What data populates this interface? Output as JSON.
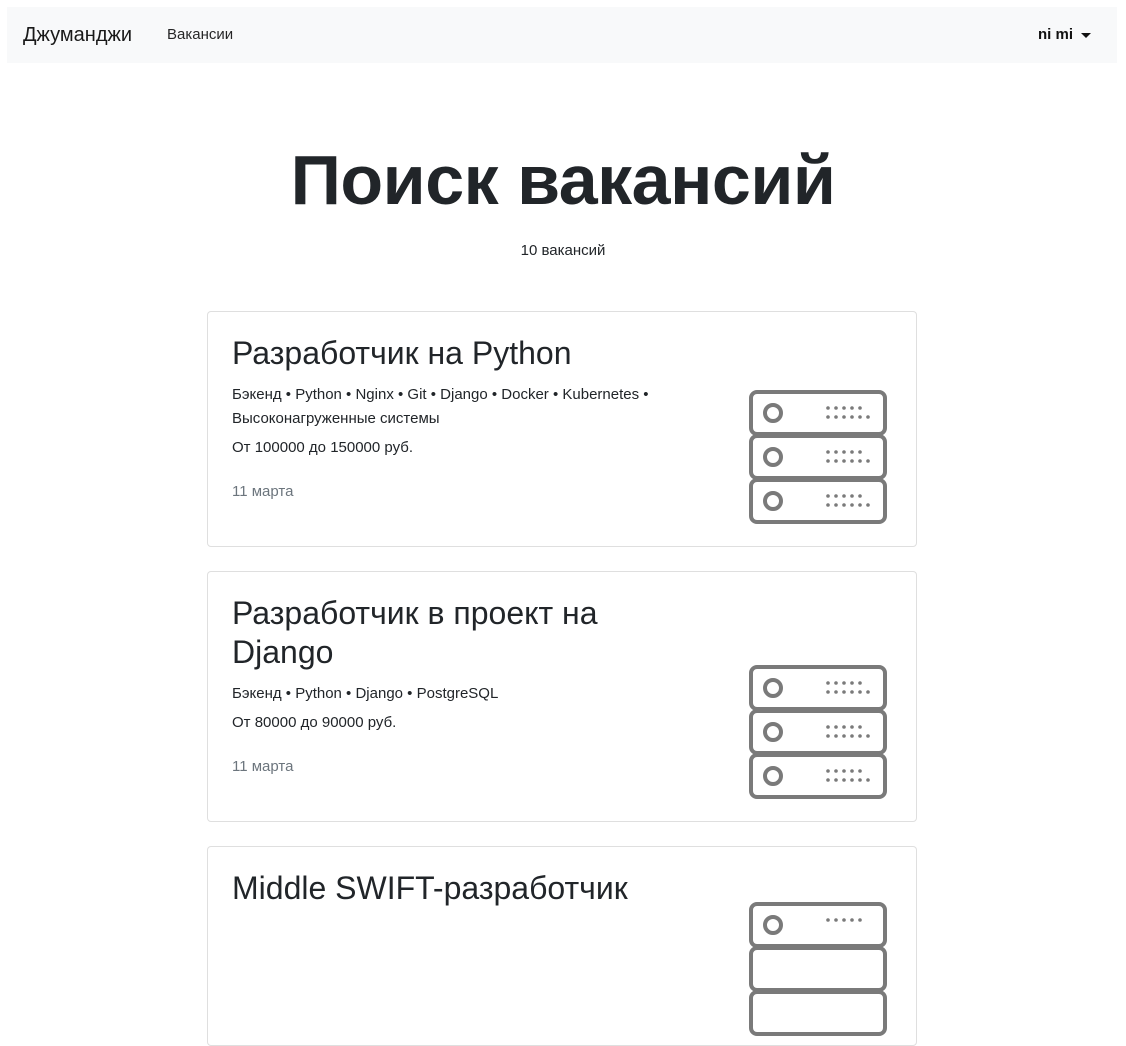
{
  "navbar": {
    "brand": "Джуманджи",
    "links": [
      {
        "label": "Вакансии"
      }
    ],
    "user": "ni mi"
  },
  "page": {
    "title": "Поиск вакансий",
    "count": "10 вакансий"
  },
  "vacancies": [
    {
      "title": "Разработчик на Python",
      "tags": "Бэкенд • Python • Nginx • Git • Django • Docker • Kubernetes • Высоконагруженные системы",
      "salary": "От 100000 до 150000 руб.",
      "date": "11 марта",
      "icon": "server-icon"
    },
    {
      "title": "Разработчик в проект на Django",
      "tags": "Бэкенд • Python • Django • PostgreSQL",
      "salary": "От 80000 до 90000 руб.",
      "date": "11 марта",
      "icon": "server-icon"
    },
    {
      "title": "Middle SWIFT-разработчик",
      "tags": "",
      "salary": "",
      "date": "",
      "icon": "server-icon"
    }
  ],
  "colors": {
    "navbar_bg": "#f8f9fa",
    "text": "#212529",
    "muted": "#6c757d",
    "icon_stroke": "#7a7a7a"
  }
}
